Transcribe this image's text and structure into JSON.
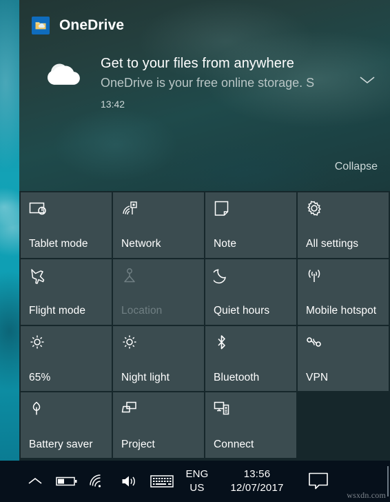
{
  "desktop": {
    "name": "windows-desktop-wallpaper"
  },
  "action_center": {
    "notification": {
      "app_name": "OneDrive",
      "app_icon": "onedrive-folder-icon",
      "logo_icon": "onedrive-cloud-icon",
      "title": "Get to your files from anywhere",
      "body": "OneDrive is your free online storage. S",
      "time": "13:42",
      "expand_icon": "chevron-down-icon",
      "collapse_label": "Collapse"
    },
    "quick_actions": [
      {
        "label": "Tablet mode",
        "icon": "tablet-mode-icon",
        "state": "enabled"
      },
      {
        "label": "Network",
        "icon": "network-wifi-icon",
        "state": "enabled"
      },
      {
        "label": "Note",
        "icon": "note-icon",
        "state": "enabled"
      },
      {
        "label": "All settings",
        "icon": "gear-icon",
        "state": "enabled"
      },
      {
        "label": "Flight mode",
        "icon": "airplane-icon",
        "state": "enabled"
      },
      {
        "label": "Location",
        "icon": "location-pin-icon",
        "state": "disabled"
      },
      {
        "label": "Quiet hours",
        "icon": "moon-icon",
        "state": "enabled"
      },
      {
        "label": "Mobile hotspot",
        "icon": "hotspot-icon",
        "state": "enabled"
      },
      {
        "label": "65%",
        "icon": "brightness-icon",
        "state": "enabled"
      },
      {
        "label": "Night light",
        "icon": "night-light-icon",
        "state": "enabled"
      },
      {
        "label": "Bluetooth",
        "icon": "bluetooth-icon",
        "state": "enabled"
      },
      {
        "label": "VPN",
        "icon": "vpn-icon",
        "state": "enabled"
      },
      {
        "label": "Battery saver",
        "icon": "leaf-icon",
        "state": "enabled"
      },
      {
        "label": "Project",
        "icon": "project-screen-icon",
        "state": "enabled"
      },
      {
        "label": "Connect",
        "icon": "connect-device-icon",
        "state": "enabled"
      }
    ]
  },
  "taskbar": {
    "tray_icons": [
      {
        "name": "show-hidden-icons-chevron-icon"
      },
      {
        "name": "battery-icon"
      },
      {
        "name": "wifi-icon"
      },
      {
        "name": "volume-icon"
      },
      {
        "name": "touch-keyboard-icon"
      }
    ],
    "language": {
      "line1": "ENG",
      "line2": "US"
    },
    "clock": {
      "time": "13:56",
      "date": "12/07/2017"
    },
    "action_center_icon": "action-center-icon",
    "watermark": "wsxdn.com"
  },
  "colors": {
    "panel_bg": "#16272b",
    "tile_bg": "#3b4c50",
    "taskbar_bg": "#06101b",
    "accent_blue": "#0f6cbd",
    "text_primary": "#ffffff",
    "text_disabled": "#707f83"
  }
}
